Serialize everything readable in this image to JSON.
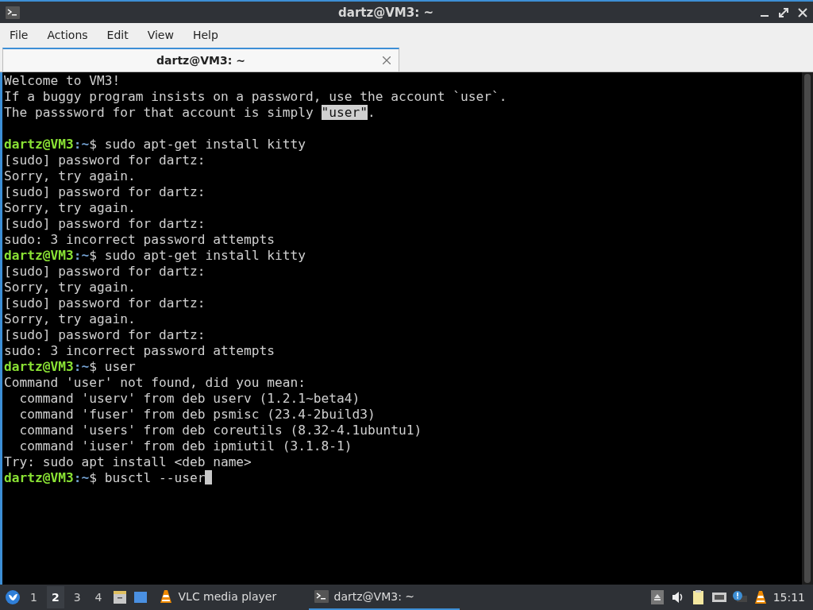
{
  "window": {
    "title": "dartz@VM3: ~"
  },
  "menu": [
    "File",
    "Actions",
    "Edit",
    "View",
    "Help"
  ],
  "tabs": [
    {
      "label": "dartz@VM3: ~",
      "selected": true
    }
  ],
  "terminal": {
    "lines": [
      {
        "kind": "text",
        "text": "Welcome to VM3!"
      },
      {
        "kind": "text",
        "text": "If a buggy program insists on a password, use the account `user`."
      },
      {
        "kind": "highlight",
        "before": "The passsword for that account is simply ",
        "highlight": "\"user\"",
        "after": "."
      },
      {
        "kind": "blank"
      },
      {
        "kind": "prompt",
        "user_host": "dartz@VM3",
        "path": ":~",
        "command": "$ sudo apt-get install kitty"
      },
      {
        "kind": "text",
        "text": "[sudo] password for dartz:"
      },
      {
        "kind": "text",
        "text": "Sorry, try again."
      },
      {
        "kind": "text",
        "text": "[sudo] password for dartz:"
      },
      {
        "kind": "text",
        "text": "Sorry, try again."
      },
      {
        "kind": "text",
        "text": "[sudo] password for dartz:"
      },
      {
        "kind": "text",
        "text": "sudo: 3 incorrect password attempts"
      },
      {
        "kind": "prompt",
        "user_host": "dartz@VM3",
        "path": ":~",
        "command": "$ sudo apt-get install kitty"
      },
      {
        "kind": "text",
        "text": "[sudo] password for dartz:"
      },
      {
        "kind": "text",
        "text": "Sorry, try again."
      },
      {
        "kind": "text",
        "text": "[sudo] password for dartz:"
      },
      {
        "kind": "text",
        "text": "Sorry, try again."
      },
      {
        "kind": "text",
        "text": "[sudo] password for dartz:"
      },
      {
        "kind": "text",
        "text": "sudo: 3 incorrect password attempts"
      },
      {
        "kind": "prompt",
        "user_host": "dartz@VM3",
        "path": ":~",
        "command": "$ user"
      },
      {
        "kind": "text",
        "text": "Command 'user' not found, did you mean:"
      },
      {
        "kind": "text",
        "text": "  command 'userv' from deb userv (1.2.1~beta4)"
      },
      {
        "kind": "text",
        "text": "  command 'fuser' from deb psmisc (23.4-2build3)"
      },
      {
        "kind": "text",
        "text": "  command 'users' from deb coreutils (8.32-4.1ubuntu1)"
      },
      {
        "kind": "text",
        "text": "  command 'iuser' from deb ipmiutil (3.1.8-1)"
      },
      {
        "kind": "text",
        "text": "Try: sudo apt install <deb name>"
      },
      {
        "kind": "prompt",
        "user_host": "dartz@VM3",
        "path": ":~",
        "command": "$ busctl --user",
        "cursor": true
      }
    ]
  },
  "taskbar": {
    "workspaces": [
      {
        "label": "1",
        "selected": false
      },
      {
        "label": "2",
        "selected": true
      },
      {
        "label": "3",
        "selected": false
      },
      {
        "label": "4",
        "selected": false
      }
    ],
    "tasks": [
      {
        "kind": "vlc",
        "label": "VLC media player",
        "selected": false
      },
      {
        "kind": "terminal",
        "label": "dartz@VM3: ~",
        "selected": true
      }
    ],
    "clock": "15:11"
  }
}
